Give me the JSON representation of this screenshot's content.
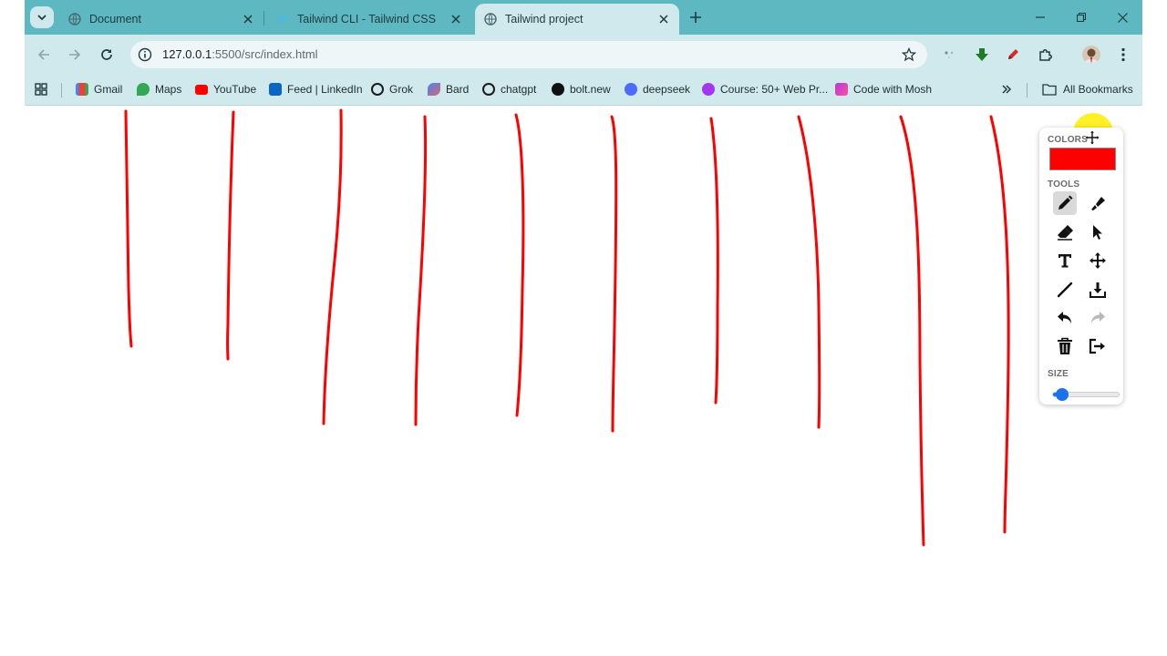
{
  "browser": {
    "tabs": [
      {
        "title": "Document",
        "active": false
      },
      {
        "title": "Tailwind CLI - Tailwind CSS",
        "active": false
      },
      {
        "title": "Tailwind project",
        "active": true
      }
    ],
    "url_host": "127.0.0.1",
    "url_rest": ":5500/src/index.html",
    "bookmarks": [
      "Gmail",
      "Maps",
      "YouTube",
      "Feed | LinkedIn",
      "Grok",
      "Bard",
      "chatgpt",
      "bolt.new",
      "deepseek",
      "Course: 50+ Web Pr...",
      "Code with Mosh"
    ],
    "all_bookmarks": "All Bookmarks",
    "accent": "#5eb8c2",
    "toolbar_bg": "#cfe9ed"
  },
  "paint_app": {
    "panel": {
      "colors_label": "COLORS",
      "selected_color": "#ff0000",
      "tools_label": "TOOLS",
      "tools": [
        "pencil-icon",
        "marker-icon",
        "eraser-icon",
        "pointer-icon",
        "text-icon",
        "move-icon",
        "line-icon",
        "download-icon",
        "undo-icon",
        "redo-icon",
        "trash-icon",
        "exit-icon"
      ],
      "active_tool": "pencil-icon",
      "size_label": "SIZE",
      "size_value": 0.14
    },
    "stroke_color": "#ff0000"
  }
}
